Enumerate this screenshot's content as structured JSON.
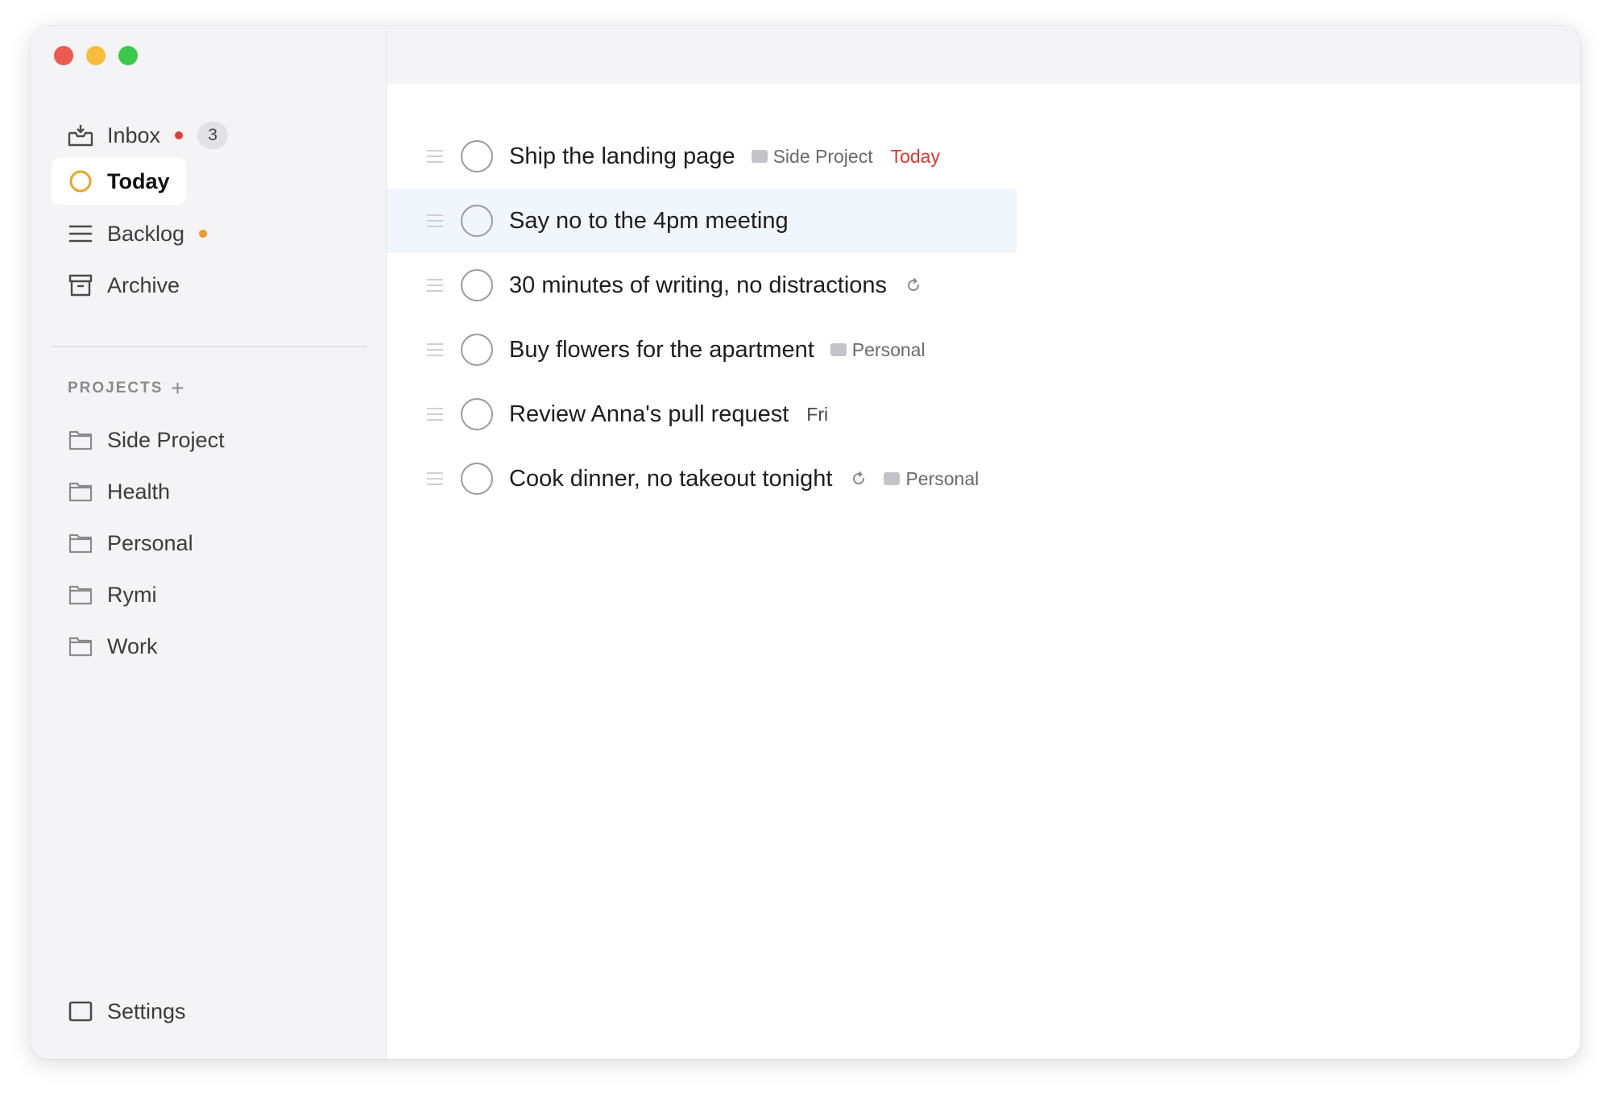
{
  "sidebar": {
    "nav": [
      {
        "label": "Inbox",
        "icon": "inbox-icon",
        "badge": "3",
        "dot_color": "#e53a35"
      },
      {
        "label": "Today",
        "icon": "today-icon"
      },
      {
        "label": "Backlog",
        "icon": "backlog-icon",
        "dot_color": "#f09a2a"
      },
      {
        "label": "Archive",
        "icon": "archive-icon"
      }
    ],
    "projects_header": "PROJECTS",
    "projects_add": "+",
    "projects": [
      "Side Project",
      "Health",
      "Personal",
      "Rymi",
      "Work"
    ],
    "settings_label": "Settings"
  },
  "tasks": [
    {
      "title": "Ship the landing page",
      "project": "Side Project",
      "due": "Today"
    },
    {
      "title": "Say no to the 4pm meeting",
      "highlighted": true
    },
    {
      "title": "30 minutes of writing, no distractions",
      "repeat": true
    },
    {
      "title": "Buy flowers for the apartment",
      "project": "Personal"
    },
    {
      "title": "Review Anna's pull request",
      "due": "Fri"
    },
    {
      "title": "Cook dinner, no takeout tonight",
      "repeat": true,
      "project": "Personal"
    }
  ],
  "colors": {
    "today_accent": "#e9a526",
    "due_today": "#d93a2e",
    "highlight_row": "#f1f5fc"
  }
}
